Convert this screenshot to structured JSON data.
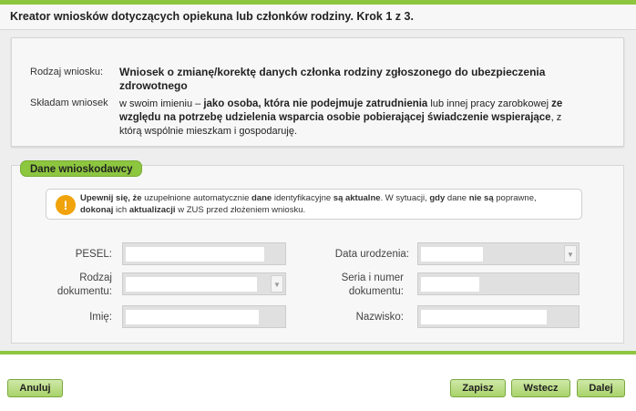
{
  "header": {
    "title": "Kreator wniosków dotyczących opiekuna lub członków rodziny. Krok 1 z 3."
  },
  "intro": {
    "type_label": "Rodzaj wniosku:",
    "type_value_line1": "Wniosek o zmianę/korektę danych członka rodziny zgłoszonego do ubezpieczenia",
    "type_value_line2": "zdrowotnego",
    "submit_label": "Składam wniosek",
    "submit_l1_a": "w swoim imieniu – ",
    "submit_l1_b": "jako osoba, która nie podejmuje zatrudnienia",
    "submit_l1_c": " lub innej pracy zarobkowej ",
    "submit_l1_d": "ze",
    "submit_l2_a": "względu na potrzebę udzielenia wsparcia osobie pobierającej świadczenie wspierające",
    "submit_l2_b": ", z",
    "submit_l3": "którą wspólnie mieszkam i gospodaruję."
  },
  "applicant": {
    "section_title": "Dane wnioskodawcy",
    "notice": {
      "icon": "warning-icon",
      "p1": "Upewnij się, że",
      "p2": " uzupełnione automatycznie ",
      "p3": "dane",
      "p4": " identyfikacyjne ",
      "p5": "są aktualne",
      "p6": ". W sytuacji, ",
      "p7": "gdy",
      "p8": " dane ",
      "p9": "nie są",
      "p10": " poprawne,",
      "p11": "dokonaj",
      "p12": " ich ",
      "p13": "aktualizacji",
      "p14": " w ZUS przed złożeniem wniosku."
    },
    "fields": {
      "pesel_label": "PESEL:",
      "birth_date_label": "Data urodzenia:",
      "doc_type_label_1": "Rodzaj",
      "doc_type_label_2": "dokumentu:",
      "doc_number_label_1": "Seria i numer",
      "doc_number_label_2": "dokumentu:",
      "first_name_label": "Imię:",
      "last_name_label": "Nazwisko:"
    }
  },
  "footer": {
    "cancel": "Anuluj",
    "save": "Zapisz",
    "back": "Wstecz",
    "next": "Dalej"
  },
  "colors": {
    "accent": "#8dc63f",
    "warning": "#f0a30a"
  }
}
